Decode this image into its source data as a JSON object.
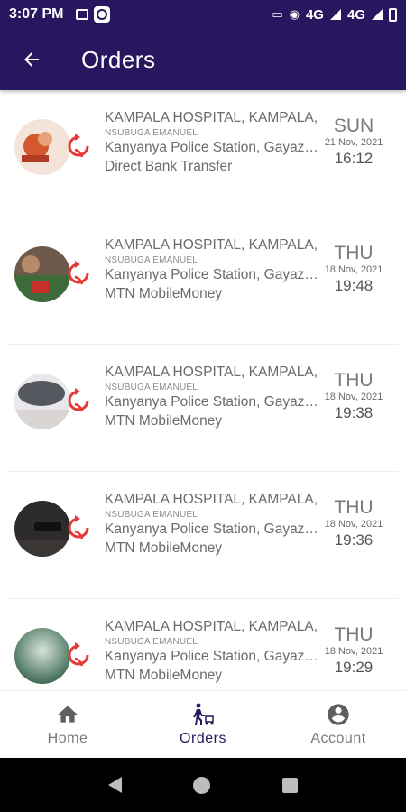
{
  "status_bar": {
    "time": "3:07 PM",
    "network1": "4G",
    "network2": "4G"
  },
  "app_bar": {
    "title": "Orders"
  },
  "orders": [
    {
      "destination": "KAMPALA HOSPITAL, KAMPALA,",
      "customer": "NSUBUGA EMANUEL",
      "pickup": "Kanyanya Police Station, Gayaza Road",
      "payment": "Direct Bank Transfer",
      "day": "SUN",
      "date": "21 Nov, 2021",
      "time": "16:12"
    },
    {
      "destination": "KAMPALA HOSPITAL, KAMPALA,",
      "customer": "NSUBUGA EMANUEL",
      "pickup": "Kanyanya Police Station, Gayaza Road",
      "payment": "MTN MobileMoney",
      "day": "THU",
      "date": "18 Nov, 2021",
      "time": "19:48"
    },
    {
      "destination": "KAMPALA HOSPITAL, KAMPALA,",
      "customer": "NSUBUGA EMANUEL",
      "pickup": "Kanyanya Police Station, Gayaza Road",
      "payment": "MTN MobileMoney",
      "day": "THU",
      "date": "18 Nov, 2021",
      "time": "19:38"
    },
    {
      "destination": "KAMPALA HOSPITAL, KAMPALA,",
      "customer": "NSUBUGA EMANUEL",
      "pickup": "Kanyanya Police Station, Gayaza Road",
      "payment": "MTN MobileMoney",
      "day": "THU",
      "date": "18 Nov, 2021",
      "time": "19:36"
    },
    {
      "destination": "KAMPALA HOSPITAL, KAMPALA,",
      "customer": "NSUBUGA EMANUEL",
      "pickup": "Kanyanya Police Station, Gayaza Road",
      "payment": "MTN MobileMoney",
      "day": "THU",
      "date": "18 Nov, 2021",
      "time": "19:29"
    }
  ],
  "bottom_nav": {
    "home": "Home",
    "orders": "Orders",
    "account": "Account"
  },
  "colors": {
    "primary": "#27175f",
    "refresh": "#e53935"
  }
}
